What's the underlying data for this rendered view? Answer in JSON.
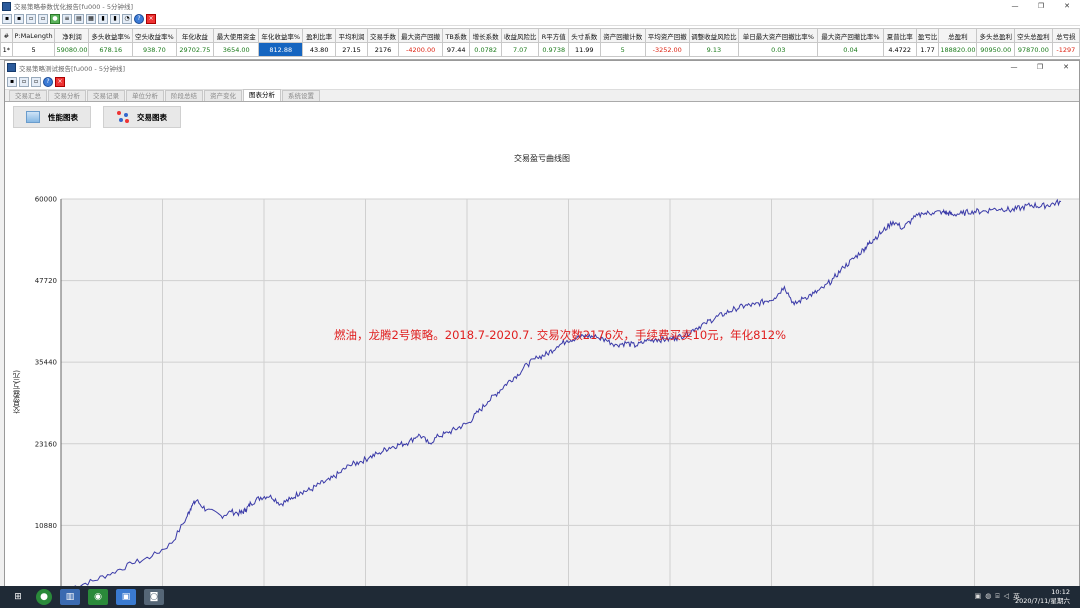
{
  "win1": {
    "title": "交易策略参数优化报告[fu000 - 5分钟线]",
    "controls": [
      "—",
      "❐",
      "✕"
    ]
  },
  "stats": {
    "headers": [
      "#",
      "P:MaLength",
      "净利润",
      "多头收益率%",
      "空头收益率%",
      "年化收益",
      "最大使用资金",
      "年化收益率%",
      "盈利比率",
      "平均利润",
      "交易手数",
      "最大资产回撤",
      "TB系数",
      "增长系数",
      "收益风险比",
      "R平方值",
      "头寸系数",
      "资产回撤计数",
      "平均资产回撤",
      "调整收益风险比",
      "单日最大资产回撤比率%",
      "最大资产回撤比率%",
      "夏普比率",
      "盈亏比",
      "总盈利",
      "多头总盈利",
      "空头总盈利",
      "总亏损"
    ],
    "values": [
      "1*",
      "5",
      "59080.00",
      "678.16",
      "938.70",
      "29702.75",
      "3654.00",
      "812.88",
      "43.80",
      "27.15",
      "2176",
      "-4200.00",
      "97.44",
      "0.0782",
      "7.07",
      "0.9738",
      "11.99",
      "5",
      "-3252.00",
      "9.13",
      "0.03",
      "0.04",
      "4.4722",
      "1.77",
      "188820.00",
      "90950.00",
      "97870.00",
      "-1297"
    ],
    "widths": [
      12,
      43,
      34,
      44,
      44,
      38,
      46,
      44,
      34,
      32,
      32,
      44,
      28,
      32,
      38,
      30,
      32,
      46,
      44,
      50,
      80,
      66,
      34,
      22,
      38,
      38,
      38,
      28
    ],
    "colors": [
      "",
      "",
      "g",
      "g",
      "g",
      "g",
      "g",
      "sel",
      "",
      "",
      "",
      "r",
      "",
      "g",
      "g",
      "g",
      "",
      "g",
      "r",
      "g",
      "g",
      "g",
      "",
      "",
      "g",
      "g",
      "g",
      "r"
    ]
  },
  "win2": {
    "title": "交易策略测试报告[fu000 - 5分钟线]",
    "controls": [
      "—",
      "❐",
      "✕"
    ]
  },
  "tabs": [
    "交易汇总",
    "交易分析",
    "交易记录",
    "单位分析",
    "阶段总结",
    "资产变化",
    "图表分析",
    "系统设置"
  ],
  "active_tab": 6,
  "buttons": {
    "perf": "性能图表",
    "trade": "交易图表"
  },
  "annotation": "燃油，龙腾2号策略。2018.7-2020.7. 交易次数2176次，手续费买卖10元，年化812%",
  "taskbar": {
    "time": "10:12",
    "date": "2020/7/11/星期六",
    "lang": "英"
  },
  "chart_data": {
    "type": "line",
    "title": "交易盈亏曲线图",
    "ylabel": "交易盈亏(元)",
    "xlabel": "",
    "yticks": [
      10880,
      23160,
      35440,
      47720,
      60000
    ],
    "ylim": [
      1600,
      60000
    ],
    "grid": true,
    "series": [
      {
        "color": "#3a3aa8",
        "x": [
          0,
          0.02,
          0.04,
          0.06,
          0.08,
          0.1,
          0.115,
          0.12,
          0.125,
          0.135,
          0.15,
          0.16,
          0.17,
          0.175,
          0.18,
          0.19,
          0.2,
          0.21,
          0.22,
          0.23,
          0.24,
          0.25,
          0.26,
          0.27,
          0.28,
          0.29,
          0.3,
          0.31,
          0.32,
          0.33,
          0.34,
          0.35,
          0.36,
          0.37,
          0.38,
          0.39,
          0.4,
          0.41,
          0.42,
          0.43,
          0.44,
          0.45,
          0.46,
          0.47,
          0.48,
          0.49,
          0.5,
          0.51,
          0.52,
          0.53,
          0.54,
          0.55,
          0.56,
          0.57,
          0.58,
          0.59,
          0.6,
          0.61,
          0.62,
          0.63,
          0.64,
          0.65,
          0.66,
          0.67,
          0.68,
          0.69,
          0.7,
          0.71,
          0.72,
          0.73,
          0.74,
          0.75,
          0.76,
          0.77,
          0.78,
          0.79,
          0.8,
          0.805,
          0.81,
          0.82,
          0.83,
          0.84,
          0.85,
          0.86,
          0.87,
          0.88,
          0.885,
          0.89,
          0.9,
          0.91,
          0.92,
          0.93,
          0.94,
          0.95,
          0.96,
          0.97,
          0.98,
          0.99,
          1.0
        ],
        "y": [
          1600,
          2500,
          3800,
          5100,
          6200,
          8200,
          12100,
          13800,
          14600,
          13200,
          12300,
          12900,
          12700,
          13200,
          14200,
          15100,
          15400,
          14100,
          14800,
          15900,
          16200,
          17100,
          17700,
          18800,
          19900,
          20400,
          21100,
          21800,
          22600,
          23000,
          23400,
          24600,
          23200,
          24300,
          24800,
          25600,
          26300,
          27900,
          29500,
          30900,
          32400,
          33600,
          35100,
          36100,
          36700,
          37800,
          38700,
          39100,
          39400,
          39200,
          38700,
          38100,
          38300,
          37900,
          38600,
          38900,
          38800,
          39100,
          39600,
          40500,
          41300,
          42100,
          42800,
          43500,
          43900,
          44100,
          44600,
          45100,
          46800,
          44100,
          45100,
          45800,
          46600,
          48100,
          49700,
          51000,
          52400,
          53200,
          53900,
          55200,
          56600,
          55600,
          57000,
          57800,
          57900,
          58100,
          57900,
          57700,
          57800,
          58200,
          58100,
          58400,
          58600,
          58300,
          58700,
          59100,
          58900,
          59200,
          59600
        ]
      }
    ]
  }
}
